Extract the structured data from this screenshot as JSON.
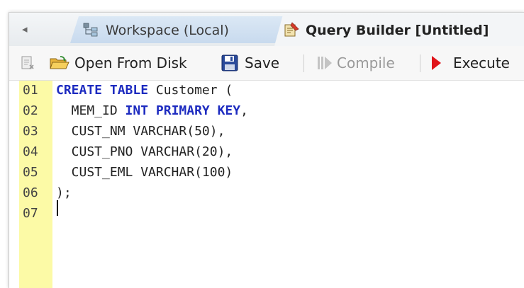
{
  "tabs": {
    "scroll_left": "◂",
    "workspace": {
      "label": "Workspace (Local)",
      "icon": "workspace-tree-icon"
    },
    "query_builder": {
      "label": "Query Builder [Untitled]",
      "icon": "query-builder-icon"
    }
  },
  "toolbar": {
    "new_icon": "new-query-icon",
    "open": {
      "label": "Open From Disk",
      "icon": "folder-open-icon"
    },
    "save": {
      "label": "Save",
      "icon": "floppy-disk-icon"
    },
    "compile": {
      "label": "Compile",
      "icon": "compile-icon",
      "disabled": true
    },
    "execute": {
      "label": "Execute",
      "icon": "play-icon",
      "color": "#e0141a"
    }
  },
  "editor": {
    "gutter_color": "#fcfaa6",
    "keyword_color": "#1d2bc0",
    "lines": [
      {
        "num": "01",
        "tokens": [
          {
            "t": "CREATE TABLE",
            "kw": true
          },
          {
            "t": " Customer ("
          }
        ]
      },
      {
        "num": "02",
        "tokens": [
          {
            "t": "  MEM_ID "
          },
          {
            "t": "INT PRIMARY KEY",
            "kw": true
          },
          {
            "t": ","
          }
        ]
      },
      {
        "num": "03",
        "tokens": [
          {
            "t": "  CUST_NM VARCHAR(50),"
          }
        ]
      },
      {
        "num": "04",
        "tokens": [
          {
            "t": "  CUST_PNO VARCHAR(20),"
          }
        ]
      },
      {
        "num": "05",
        "tokens": [
          {
            "t": "  CUST_EML VARCHAR(100)"
          }
        ]
      },
      {
        "num": "06",
        "tokens": [
          {
            "t": ");"
          }
        ]
      },
      {
        "num": "07",
        "tokens": [
          {
            "t": ""
          }
        ]
      }
    ]
  }
}
